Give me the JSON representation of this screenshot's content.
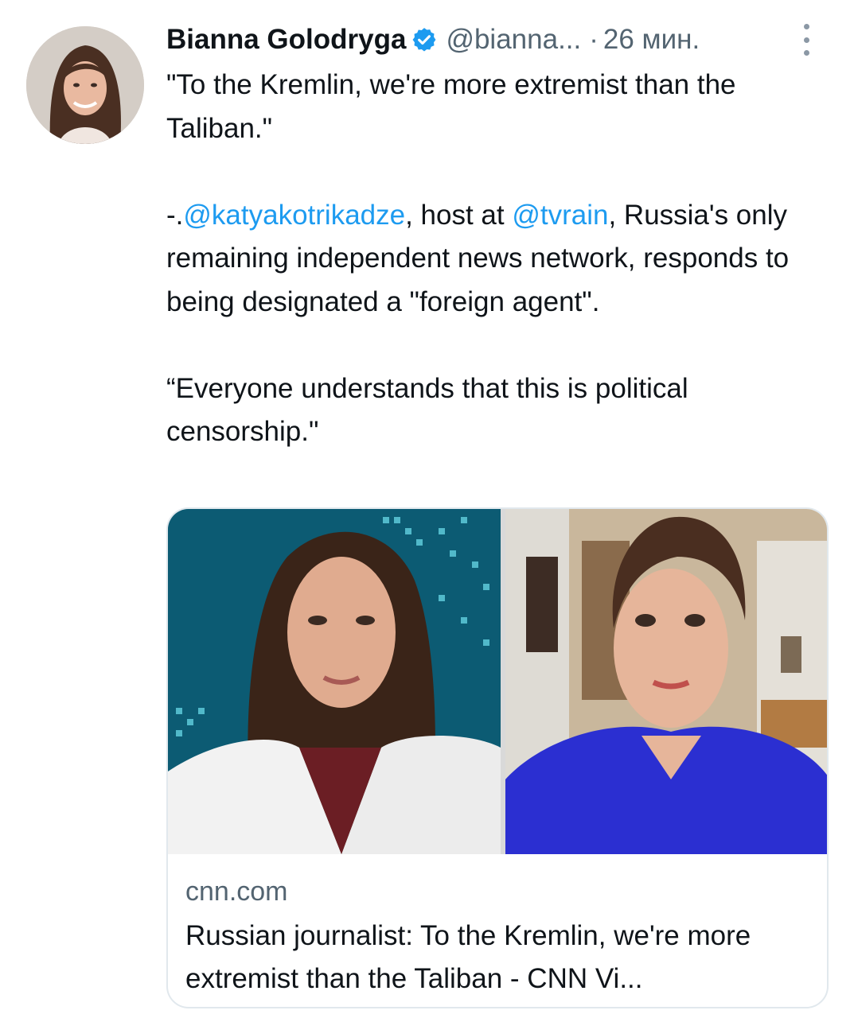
{
  "author": {
    "display_name": "Bianna Golodryga",
    "handle": "@bianna...",
    "separator": "·",
    "time": "26 мин.",
    "verified": true,
    "avatar_icon": "profile-photo"
  },
  "tweet": {
    "line1": "\"To the Kremlin, we're more extremist than the Taliban.\"",
    "p2_prefix": "-.",
    "p2_mention1": "@katyakotrikadze",
    "p2_mid": ", host at ",
    "p2_mention2": "@tvrain",
    "p2_suffix": ", Russia's only remaining independent news network, responds to being designated a \"foreign agent\".",
    "line3": "“Everyone understands that this is political censorship.\""
  },
  "card": {
    "domain": "cnn.com",
    "title": "Russian journalist: To the Kremlin, we're more extremist than the Taliban - CNN Vi..."
  },
  "colors": {
    "link": "#1d9bf0",
    "secondary_text": "#536471",
    "verified_badge": "#1d9bf0"
  }
}
